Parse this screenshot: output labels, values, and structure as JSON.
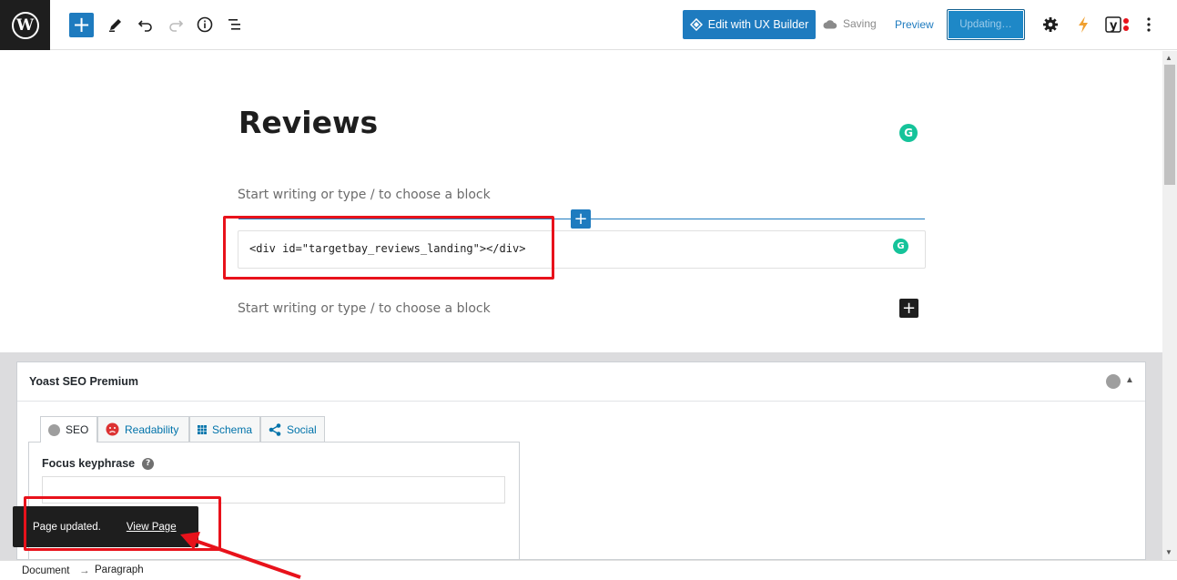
{
  "toolbar": {
    "add_block_glyph": "+",
    "edit_ux_builder_label": "Edit with UX Builder",
    "saving_label": "Saving",
    "preview_label": "Preview",
    "updating_label": "Updating…",
    "icons": [
      "wordpress-logo",
      "add-block",
      "pencil-tools",
      "undo",
      "redo",
      "info",
      "list-view",
      "ux-builder-diamond",
      "cloud",
      "settings-gear",
      "lightning",
      "yoast",
      "more-vertical"
    ]
  },
  "editor": {
    "page_title": "Reviews",
    "placeholder_1": "Start writing or type / to choose a block",
    "html_block_content": "<div id=\"targetbay_reviews_landing\"></div>",
    "placeholder_2": "Start writing or type / to choose a block",
    "grammarly_glyph": "G",
    "inserter_glyph": "+"
  },
  "yoast": {
    "title": "Yoast SEO Premium",
    "tabs": [
      {
        "label": "SEO",
        "icon": "grey-dot"
      },
      {
        "label": "Readability",
        "icon": "sad-face"
      },
      {
        "label": "Schema",
        "icon": "grid"
      },
      {
        "label": "Social",
        "icon": "share"
      }
    ],
    "focus_keyphrase_label": "Focus keyphrase",
    "focus_keyphrase_value": "",
    "help_glyph": "?"
  },
  "snackbar": {
    "message": "Page updated.",
    "link_label": "View Page"
  },
  "breadcrumb": {
    "items": [
      "Document",
      "Paragraph"
    ],
    "separator": "→"
  },
  "colors": {
    "accent": "#1e7bbf",
    "annotation_red": "#e8121b",
    "grammarly_green": "#15c39a",
    "snackbar_bg": "#1e1e1e"
  }
}
